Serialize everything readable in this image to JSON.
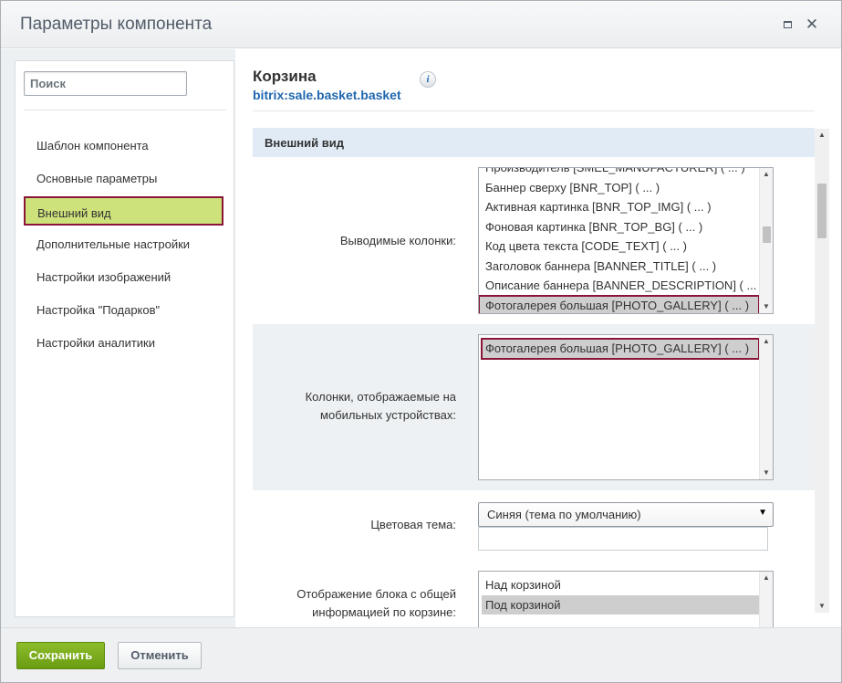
{
  "dialog": {
    "title": "Параметры компонента",
    "maximize_icon": "maximize-icon",
    "close_glyph": "✕"
  },
  "sidebar": {
    "search_placeholder": "Поиск",
    "items": [
      {
        "label": "Шаблон компонента",
        "active": false
      },
      {
        "label": "Основные параметры",
        "active": false
      },
      {
        "label": "Внешний вид",
        "active": true
      },
      {
        "label": "Дополнительные настройки",
        "active": false
      },
      {
        "label": "Настройки изображений",
        "active": false
      },
      {
        "label": "Настройка \"Подарков\"",
        "active": false
      },
      {
        "label": "Настройки аналитики",
        "active": false
      }
    ]
  },
  "component": {
    "name": "Корзина",
    "code": "bitrix:sale.basket.basket",
    "info_glyph": "i"
  },
  "section": {
    "title": "Внешний вид"
  },
  "fields": {
    "columns": {
      "label": "Выводимые колонки:",
      "options": [
        "Производитель [SMEL_MANUFACTURER] ( ... )",
        "Баннер сверху [BNR_TOP] ( ... )",
        "Активная картинка [BNR_TOP_IMG] ( ... )",
        "Фоновая картинка [BNR_TOP_BG] ( ... )",
        "Код цвета текста [CODE_TEXT] ( ... )",
        "Заголовок баннера [BANNER_TITLE] ( ... )",
        "Описание баннера [BANNER_DESCRIPTION] ( ... )",
        "Фотогалерея большая [PHOTO_GALLERY] ( ... )"
      ],
      "selected": "Фотогалерея большая [PHOTO_GALLERY] ( ... )"
    },
    "mobile_columns": {
      "label_line1": "Колонки, отображаемые на",
      "label_line2": "мобильных устройствах:",
      "options": [
        "Фотогалерея большая [PHOTO_GALLERY] ( ... )"
      ],
      "selected": "Фотогалерея большая [PHOTO_GALLERY] ( ... )"
    },
    "color_theme": {
      "label": "Цветовая тема:",
      "value": "Синяя (тема по умолчанию)"
    },
    "total_block": {
      "label_line1": "Отображение блока с общей",
      "label_line2": "информацией по корзине:",
      "options": [
        "Над корзиной",
        "Под корзиной"
      ],
      "selected": "Под корзиной"
    }
  },
  "footer": {
    "save_label": "Сохранить",
    "cancel_label": "Отменить"
  },
  "colors": {
    "accent_green": "#7aab1c",
    "active_item_bg": "#cde27b",
    "highlight_border": "#8a1538",
    "link_blue": "#2067b0"
  }
}
